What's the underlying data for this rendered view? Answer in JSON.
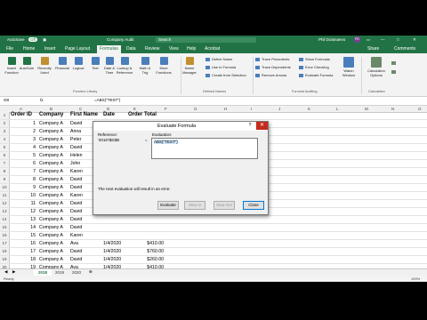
{
  "titlebar": {
    "autosave": "AutoSave",
    "autosave_state": "Off",
    "doc_title": "Company Audit",
    "search": "Search",
    "user": "Phil Dolanaevo",
    "user_initials": "PD"
  },
  "menu": {
    "tabs": [
      "File",
      "Home",
      "Insert",
      "Page Layout",
      "Formulas",
      "Data",
      "Review",
      "View",
      "Help",
      "Acrobat"
    ],
    "active": "Formulas",
    "share": "Share",
    "comments": "Comments"
  },
  "ribbon": {
    "buttons": [
      {
        "label": "Insert\nFunction",
        "color": "#217346"
      },
      {
        "label": "AutoSum",
        "color": "#217346"
      },
      {
        "label": "Recently\nUsed",
        "color": "#c09030"
      },
      {
        "label": "Financial",
        "color": "#4a7ebb"
      },
      {
        "label": "Logical",
        "color": "#4a7ebb"
      },
      {
        "label": "Text",
        "color": "#4a7ebb"
      },
      {
        "label": "Date &\nTime",
        "color": "#4a7ebb"
      },
      {
        "label": "Lookup &\nReference",
        "color": "#4a7ebb"
      },
      {
        "label": "Math &\nTrig",
        "color": "#4a7ebb"
      },
      {
        "label": "More\nFunctions",
        "color": "#4a7ebb"
      },
      {
        "label": "Name\nManager",
        "color": "#c09030"
      }
    ],
    "group_function_library": "Function Library",
    "defined_names_items": [
      "Define Name",
      "Use in Formula",
      "Create from Selection"
    ],
    "group_defined_names": "Defined Names",
    "auditing_left": [
      "Trace Precedents",
      "Trace Dependents",
      "Remove Arrows"
    ],
    "auditing_right": [
      "Show Formulas",
      "Error Checking",
      "Evaluate Formula"
    ],
    "watch_window": "Watch\nWindow",
    "group_formula_auditing": "Formula Auditing",
    "calc_options": "Calculation\nOptions",
    "group_calculation": "Calculation"
  },
  "formula_bar": {
    "name_box": "G8",
    "fx": "fx",
    "formula": "=ABS(\"TEST\")"
  },
  "columns": [
    "A",
    "B",
    "C",
    "D",
    "E",
    "F",
    "G",
    "H",
    "I",
    "J",
    "K",
    "L",
    "M",
    "N",
    "O",
    "P"
  ],
  "table": {
    "headers": [
      "Order ID",
      "Company",
      "First Name",
      "Date",
      "Order Total"
    ],
    "rows": [
      [
        "1",
        "Company A",
        "David",
        "",
        ""
      ],
      [
        "2",
        "Company A",
        "Anna",
        "",
        ""
      ],
      [
        "3",
        "Company A",
        "Peter",
        "",
        ""
      ],
      [
        "4",
        "Company A",
        "David",
        "",
        ""
      ],
      [
        "5",
        "Company A",
        "Helen",
        "",
        ""
      ],
      [
        "6",
        "Company A",
        "John",
        "",
        ""
      ],
      [
        "7",
        "Company A",
        "Karen",
        "",
        ""
      ],
      [
        "8",
        "Company A",
        "David",
        "",
        ""
      ],
      [
        "9",
        "Company A",
        "David",
        "",
        ""
      ],
      [
        "10",
        "Company A",
        "Karen",
        "",
        ""
      ],
      [
        "11",
        "Company A",
        "David",
        "",
        ""
      ],
      [
        "12",
        "Company A",
        "David",
        "",
        ""
      ],
      [
        "13",
        "Company A",
        "David",
        "",
        ""
      ],
      [
        "14",
        "Company A",
        "David",
        "",
        ""
      ],
      [
        "15",
        "Company A",
        "Karen",
        "",
        ""
      ],
      [
        "16",
        "Company A",
        "Ava",
        "1/4/2020",
        "$410.00"
      ],
      [
        "17",
        "Company A",
        "David",
        "1/4/2020",
        "$760.00"
      ],
      [
        "18",
        "Company A",
        "David",
        "1/4/2020",
        "$260.00"
      ],
      [
        "19",
        "Company A",
        "Ava",
        "1/4/2020",
        "$410.00"
      ]
    ]
  },
  "dialog": {
    "title": "Evaluate Formula",
    "help": "?",
    "close": "✕",
    "reference_label": "Reference:",
    "reference_value": "'2018'!$G$8",
    "equals": "=",
    "evaluation_label": "Evaluation:",
    "evaluation_value": "ABS(\"TEST\")",
    "message": "The next evaluation will result in an error.",
    "buttons": {
      "evaluate": "Evaluate",
      "step_in": "Step In",
      "step_out": "Step Out",
      "close": "Close"
    }
  },
  "sheets": {
    "tabs": [
      "2018",
      "2019",
      "2020"
    ],
    "active": "2018"
  },
  "status": {
    "ready": "Ready",
    "zoom": "100%"
  }
}
